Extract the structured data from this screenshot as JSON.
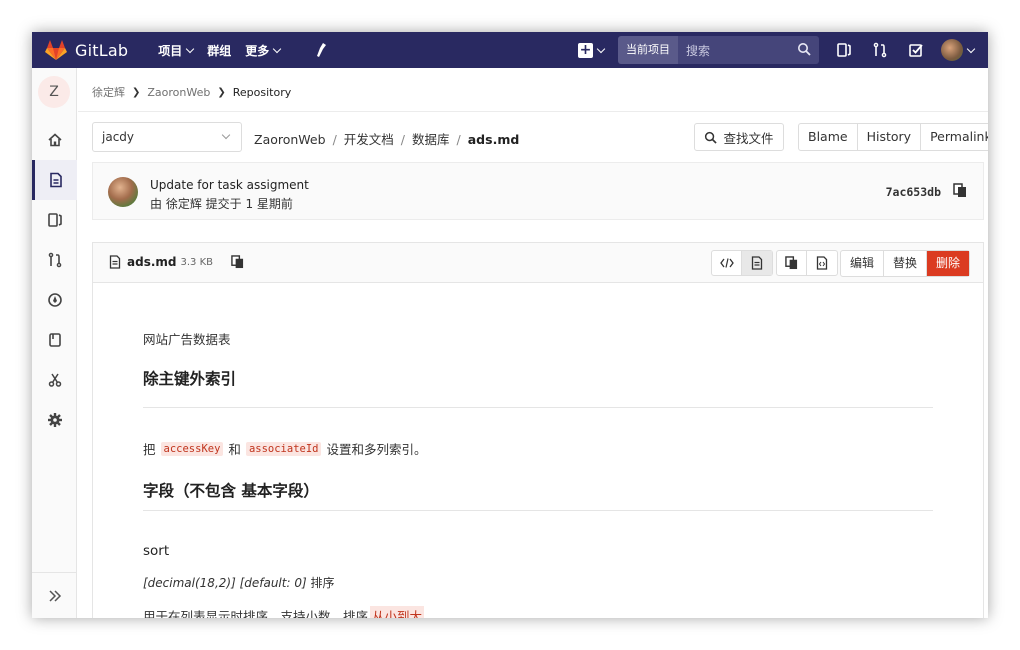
{
  "nav": {
    "brand": "GitLab",
    "links": [
      "项目",
      "群组",
      "更多"
    ],
    "search_scope": "当前项目",
    "search_placeholder": "搜索"
  },
  "sidebar": {
    "project_initial": "Z"
  },
  "breadcrumb": {
    "user": "徐定辉",
    "project": "ZaoronWeb",
    "current": "Repository"
  },
  "repo": {
    "branch": "jacdy",
    "path": [
      "ZaoronWeb",
      "开发文档",
      "数据库"
    ],
    "file": "ads.md",
    "find_file": "查找文件",
    "actions": [
      "Blame",
      "History",
      "Permalink"
    ]
  },
  "commit": {
    "title": "Update for task assigment",
    "meta": "由 徐定辉 提交于 1 星期前",
    "sha": "7ac653db"
  },
  "file": {
    "name": "ads.md",
    "size": "3.3 KB",
    "edit": "编辑",
    "replace": "替换",
    "delete": "删除"
  },
  "content": {
    "intro": "网站广告数据表",
    "h_index": "除主键外索引",
    "p_index_pre": "把",
    "code_a": "accessKey",
    "p_index_mid": "和",
    "code_b": "associateId",
    "p_index_post": "设置和多列索引。",
    "h_fields": "字段（不包含 基本字段）",
    "h_sort": "sort",
    "sort_type": "[decimal(18,2)] [default: 0]",
    "sort_type_label": "排序",
    "sort_desc_pre": "用于在列表显示时排序，支持小数。排序",
    "sort_desc_hl": "从小到大",
    "sort_desc_post": "。"
  },
  "colors": {
    "nav_bg": "#292961",
    "delete_btn": "#db3b21",
    "code_text": "#c0341d"
  }
}
